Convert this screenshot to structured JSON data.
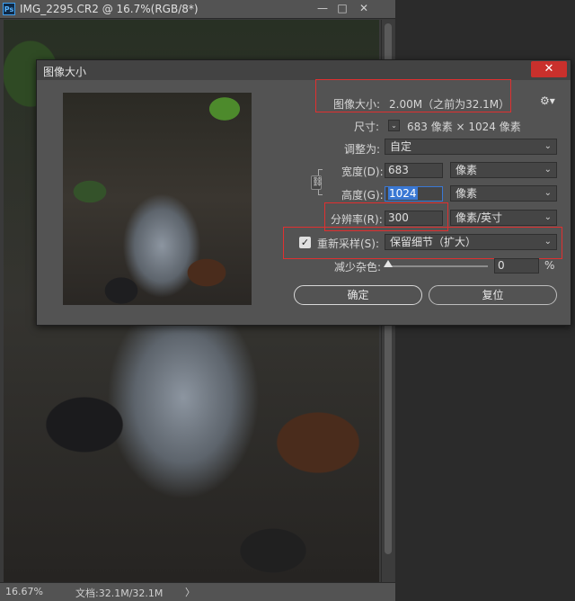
{
  "document": {
    "title": "IMG_2295.CR2 @ 16.7%(RGB/8*)",
    "app_icon": "Ps",
    "window_buttons": [
      "—",
      "□",
      "✕"
    ],
    "status": {
      "zoom": "16.67%",
      "doc_size": "文档:32.1M/32.1M",
      "arrow": "〉"
    }
  },
  "dialog": {
    "title": "图像大小",
    "close_label": "✕",
    "image_size_label": "图像大小:",
    "image_size_value": "2.00M（之前为32.1M）",
    "dimensions": {
      "label": "尺寸:",
      "value": "683 像素 × 1024 像素"
    },
    "fit_to": {
      "label": "调整为:",
      "value": "自定"
    },
    "width": {
      "label": "宽度(D):",
      "value": "683",
      "unit": "像素"
    },
    "height": {
      "label": "高度(G):",
      "value": "1024",
      "unit": "像素"
    },
    "resolution": {
      "label": "分辨率(R):",
      "value": "300",
      "unit": "像素/英寸"
    },
    "resample": {
      "label": "重新采样(S):",
      "checked": true,
      "check_mark": "✓",
      "value": "保留细节（扩大）"
    },
    "noise": {
      "label": "减少杂色:",
      "value": "0",
      "unit": "%",
      "level": 0
    },
    "ok_button": "确定",
    "reset_button": "复位"
  }
}
